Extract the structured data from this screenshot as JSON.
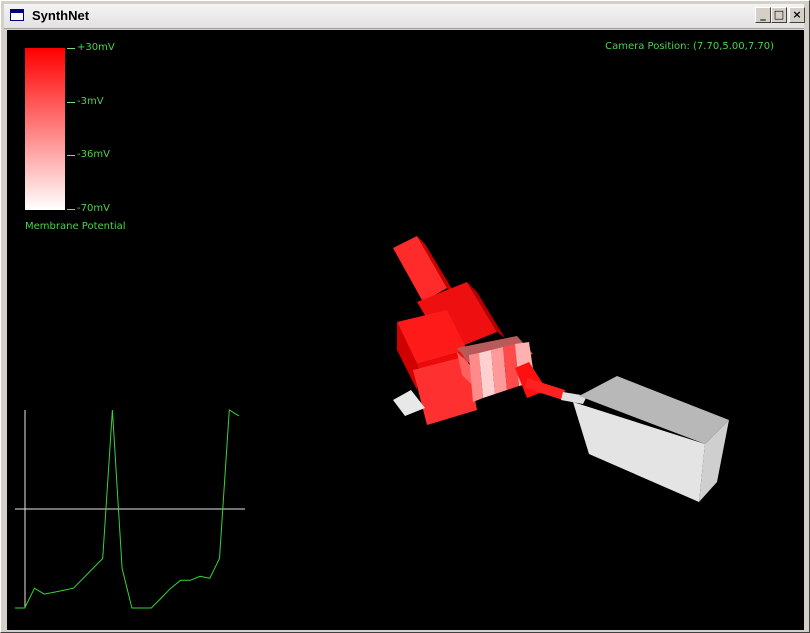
{
  "window": {
    "title": "SynthNet"
  },
  "title_buttons": {
    "minimize": "_",
    "maximize": "□",
    "close": "×"
  },
  "colorbar": {
    "labels": [
      "+30mV",
      "-3mV",
      "-36mV",
      "-70mV"
    ],
    "title": "Membrane Potential",
    "colors": {
      "top": "#ff0000",
      "bottom": "#ffffff"
    }
  },
  "camera": {
    "text": "Camera Position: (7.70,5.00,7.70)"
  },
  "trace": {
    "color": "#33d633",
    "axis_color": "#e6e6e6",
    "points_mv": [
      -70,
      -70,
      -60,
      -63,
      -62,
      -61,
      -60,
      -55,
      -50,
      -45,
      30,
      -50,
      -70,
      -70,
      -70,
      -65,
      -60,
      -56,
      -56,
      -54,
      -55,
      -45,
      30,
      27
    ]
  }
}
